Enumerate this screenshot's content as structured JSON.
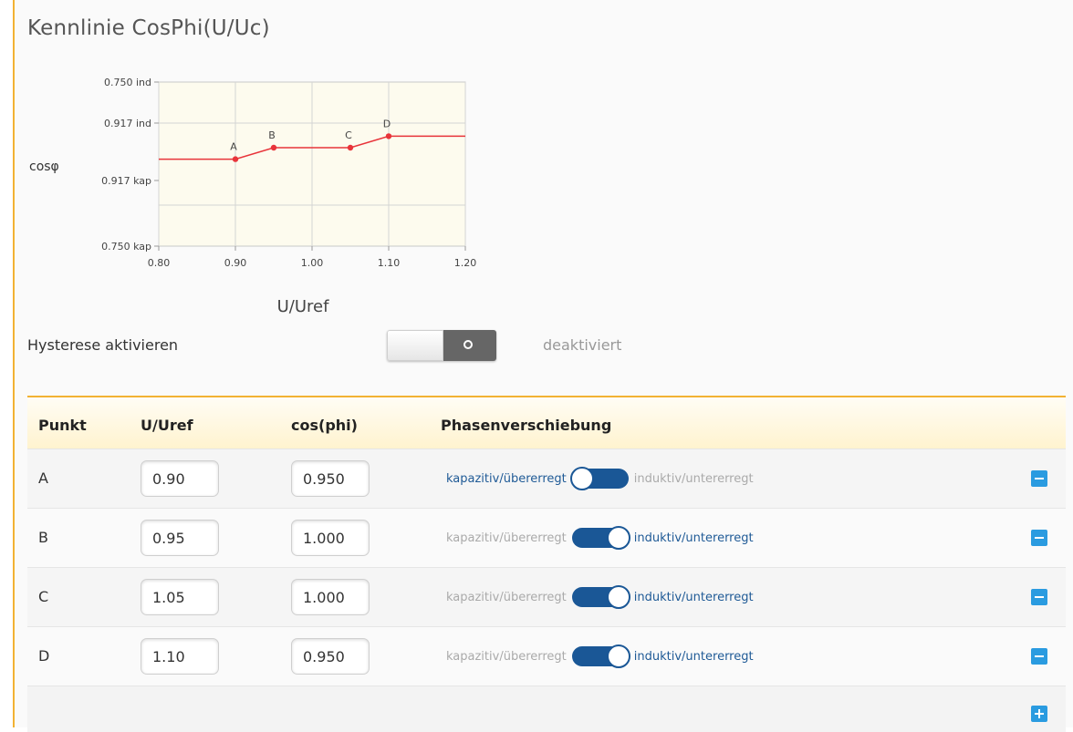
{
  "page": {
    "title": "Kennlinie CosPhi(U/Uc)"
  },
  "colors": {
    "accent": "#f2b233",
    "chart_line": "#e8343a",
    "chart_bg": "#fdfbee",
    "toggle_blue": "#1a5796",
    "button_blue": "#2a9be0"
  },
  "chart_data": {
    "type": "line",
    "title": "",
    "xlabel": "U/Uref",
    "ylabel": "cosφ",
    "xlim": [
      0.8,
      1.2
    ],
    "x_ticks": [
      "0.80",
      "0.90",
      "1.00",
      "1.10",
      "1.20"
    ],
    "y_ticks": [
      "0.750 ind",
      "0.917 ind",
      "0.917 kap",
      "0.750 kap"
    ],
    "grid": true,
    "series": [
      {
        "points": [
          {
            "x": 0.8,
            "y": 0.95,
            "phase": "kap"
          },
          {
            "x": 0.9,
            "y": 0.95,
            "phase": "kap",
            "label": "A"
          },
          {
            "x": 0.95,
            "y": 1.0,
            "label": "B"
          },
          {
            "x": 1.05,
            "y": 1.0,
            "label": "C"
          },
          {
            "x": 1.1,
            "y": 0.95,
            "phase": "ind",
            "label": "D"
          },
          {
            "x": 1.2,
            "y": 0.95,
            "phase": "ind"
          }
        ]
      }
    ]
  },
  "hysteresis": {
    "label": "Hysterese aktivieren",
    "status": "deaktiviert",
    "enabled": false
  },
  "table": {
    "headers": {
      "punkt": "Punkt",
      "uref": "U/Uref",
      "cosphi": "cos(phi)",
      "phase": "Phasenverschiebung"
    },
    "capacitive_label": "kapazitiv/übererregt",
    "inductive_label": "induktiv/untererregt",
    "rows": [
      {
        "punkt": "A",
        "uref": "0.90",
        "cosphi": "0.950",
        "phase": "kapazitiv"
      },
      {
        "punkt": "B",
        "uref": "0.95",
        "cosphi": "1.000",
        "phase": "induktiv"
      },
      {
        "punkt": "C",
        "uref": "1.05",
        "cosphi": "1.000",
        "phase": "induktiv"
      },
      {
        "punkt": "D",
        "uref": "1.10",
        "cosphi": "0.950",
        "phase": "induktiv"
      }
    ]
  }
}
